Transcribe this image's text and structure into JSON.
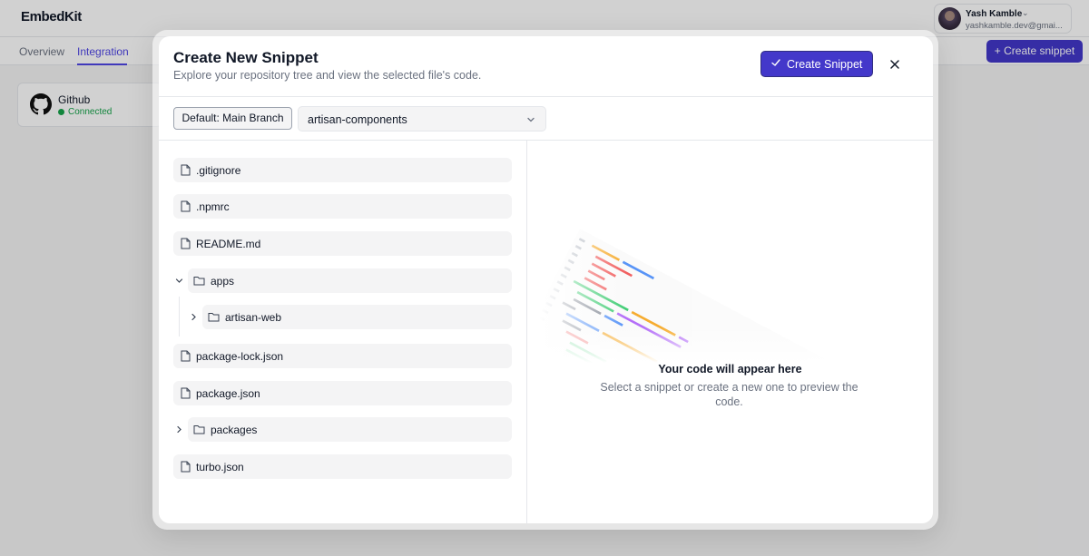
{
  "app": {
    "brand": "EmbedKit"
  },
  "user": {
    "name": "Yash Kamble",
    "email": "yashkamble.dev@gmai..."
  },
  "subnav": {
    "tabs": [
      {
        "label": "Overview"
      },
      {
        "label": "Integration"
      }
    ],
    "active_tab": "Integration",
    "create_label": "+ Create snippet"
  },
  "integration": {
    "name": "Github",
    "status": "Connected"
  },
  "modal": {
    "title": "Create New Snippet",
    "subtitle": "Explore your repository tree and view the selected file's code.",
    "primary_label": "Create Snippet",
    "branch_label": "Default: Main Branch",
    "repo_selected": "artisan-components"
  },
  "tree": [
    {
      "name": ".gitignore",
      "type": "file"
    },
    {
      "name": ".npmrc",
      "type": "file"
    },
    {
      "name": "README.md",
      "type": "file"
    },
    {
      "name": "apps",
      "type": "folder",
      "expanded": true
    },
    {
      "name": "artisan-web",
      "type": "folder",
      "expanded": false
    },
    {
      "name": "package-lock.json",
      "type": "file"
    },
    {
      "name": "package.json",
      "type": "file"
    },
    {
      "name": "packages",
      "type": "folder",
      "expanded": false
    },
    {
      "name": "turbo.json",
      "type": "file"
    }
  ],
  "preview": {
    "empty_title": "Your code will appear here",
    "empty_subtitle": "Select a snippet or create a new one to preview the code."
  },
  "colors": {
    "accent": "#4338ca",
    "success": "#16a34a",
    "muted_text": "#6b7280",
    "row_bg": "#f4f4f5"
  }
}
